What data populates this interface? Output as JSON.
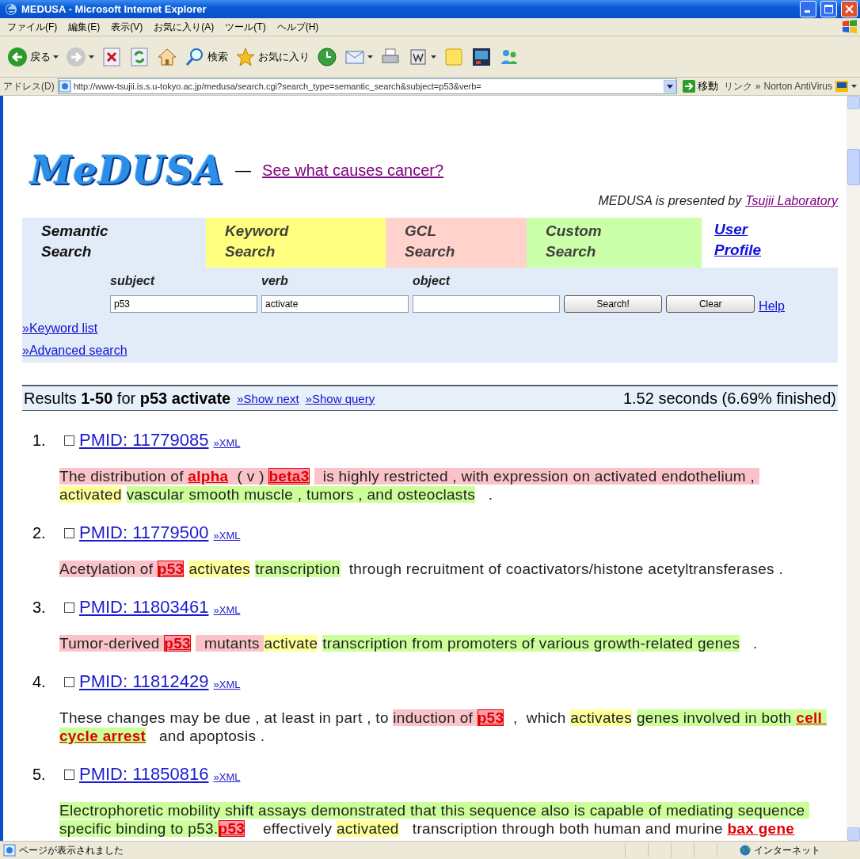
{
  "window": {
    "title": "MEDUSA - Microsoft Internet Explorer"
  },
  "menu": [
    "ファイル(F)",
    "編集(E)",
    "表示(V)",
    "お気に入り(A)",
    "ツール(T)",
    "ヘルプ(H)"
  ],
  "toolbar": [
    {
      "kind": "back",
      "label": "戻る",
      "dropdown": true
    },
    {
      "kind": "forward",
      "dropdown": true
    },
    {
      "kind": "stop"
    },
    {
      "kind": "refresh"
    },
    {
      "kind": "home"
    },
    {
      "kind": "search",
      "label": "検索"
    },
    {
      "kind": "favorites",
      "label": "お気に入り"
    },
    {
      "kind": "history"
    },
    {
      "kind": "mail",
      "dropdown": true
    },
    {
      "kind": "print"
    },
    {
      "kind": "edit",
      "dropdown": true
    },
    {
      "kind": "note"
    },
    {
      "kind": "messenger"
    },
    {
      "kind": "people"
    }
  ],
  "address_bar": {
    "label": "アドレス(D)",
    "url": "http://www-tsujii.is.s.u-tokyo.ac.jp/medusa/search.cgi?search_type=semantic_search&subject=p53&verb=",
    "go": "移動",
    "links": "リンク",
    "more": "»",
    "norton": "Norton AntiVirus"
  },
  "page": {
    "logo": "MeDUSA",
    "dash": "—",
    "tagline": "See what causes cancer?",
    "credit": "MEDUSA is presented by",
    "credit_link": "Tsujii Laboratory",
    "tabs": [
      {
        "kind": "tab",
        "label": "Semantic Search",
        "selected": true,
        "color": "#e2ecf9"
      },
      {
        "kind": "tab",
        "label": "Keyword Search",
        "selected": false,
        "color": "#ffff80"
      },
      {
        "kind": "tab",
        "label": "GCL Search",
        "selected": false,
        "color": "#ffd2cc"
      },
      {
        "kind": "tab",
        "label": "Custom Search",
        "selected": false,
        "color": "#ccffaa"
      },
      {
        "kind": "link",
        "label": "User Profile",
        "selected": false
      }
    ],
    "form": {
      "fields": [
        {
          "label": "subject",
          "value": "p53"
        },
        {
          "label": "verb",
          "value": "activate"
        },
        {
          "label": "object"
        }
      ],
      "buttons": [
        "Search!",
        "Clear"
      ],
      "help": "Help"
    },
    "side_links": [
      "»Keyword list",
      "»Advanced search"
    ],
    "results_header": {
      "summary": "Results **1-50** for **p53 activate**",
      "links": [
        "»Show next",
        "»Show query"
      ],
      "timing": "1.52 seconds (6.69% finished)"
    },
    "results": [
      {
        "number": "1.",
        "checked": false,
        "pmid": "PMID: 11779085",
        "xml": "»XML",
        "sentence": [
          {
            "text": "The distribution of ",
            "kind": "subject"
          },
          {
            "text": "alpha",
            "kind": "subject",
            "underlined": true
          },
          {
            "text": "  ( v ) ",
            "kind": "subject"
          },
          {
            "text": "beta3",
            "kind": "subject",
            "boxed": true
          },
          {
            "text": "  is highly restricted , with expression on activated endothelium , ",
            "kind": "subject"
          },
          {
            "text": "activated",
            "kind": "verb"
          },
          {
            "text": "vascular smooth muscle , tumors , and osteoclasts",
            "kind": "object"
          },
          {
            "text": "   .",
            "kind": "plain"
          }
        ]
      },
      {
        "number": "2.",
        "checked": false,
        "pmid": "PMID: 11779500",
        "xml": "»XML",
        "sentence": [
          {
            "text": "Acetylation of ",
            "kind": "subject"
          },
          {
            "text": "p53",
            "kind": "subject",
            "boxed": true
          },
          {
            "text": "activates",
            "kind": "verb"
          },
          {
            "text": "transcription",
            "kind": "object"
          },
          {
            "text": "  through recruitment of coactivators/histone acetyltransferases .",
            "kind": "plain"
          }
        ]
      },
      {
        "number": "3.",
        "checked": false,
        "pmid": "PMID: 11803461",
        "xml": "»XML",
        "sentence": [
          {
            "text": "Tumor-derived ",
            "kind": "subject"
          },
          {
            "text": "p53",
            "kind": "subject",
            "boxed": true
          },
          {
            "text": "  mutants ",
            "kind": "subject"
          },
          {
            "text": "activate",
            "kind": "verb"
          },
          {
            "text": "transcription from promoters of various growth-related genes",
            "kind": "object"
          },
          {
            "text": "   .",
            "kind": "plain"
          }
        ]
      },
      {
        "number": "4.",
        "checked": false,
        "pmid": "PMID: 11812429",
        "xml": "»XML",
        "sentence": [
          {
            "text": "These changes may be due , at least in part , to ",
            "kind": "plain"
          },
          {
            "text": "induction of ",
            "kind": "subject"
          },
          {
            "text": "p53",
            "kind": "subject",
            "boxed": true
          },
          {
            "text": " ,  which ",
            "kind": "plain"
          },
          {
            "text": "activates",
            "kind": "verb"
          },
          {
            "text": "genes involved in both ",
            "kind": "object"
          },
          {
            "text": "cell cycle arrest",
            "kind": "object",
            "underlined": true
          },
          {
            "text": "   and apoptosis .",
            "kind": "plain"
          }
        ]
      },
      {
        "number": "5.",
        "checked": false,
        "pmid": "PMID: 11850816",
        "xml": "»XML",
        "sentence": [
          {
            "text": "Electrophoretic mobility shift assays demonstrated that this sequence also is capable of mediating sequence specific binding to p53.",
            "kind": "object"
          },
          {
            "text": "p53",
            "kind": "subject",
            "boxed": true
          },
          {
            "text": "   effectively ",
            "kind": "plain"
          },
          {
            "text": "activated",
            "kind": "verb"
          },
          {
            "text": "  transcription through both human and murine ",
            "kind": "plain"
          },
          {
            "text": "bax gene",
            "kind": "plain",
            "underlined": true
          }
        ]
      }
    ]
  },
  "status_bar": {
    "text": "ページが表示されました",
    "zone": "インターネット"
  }
}
